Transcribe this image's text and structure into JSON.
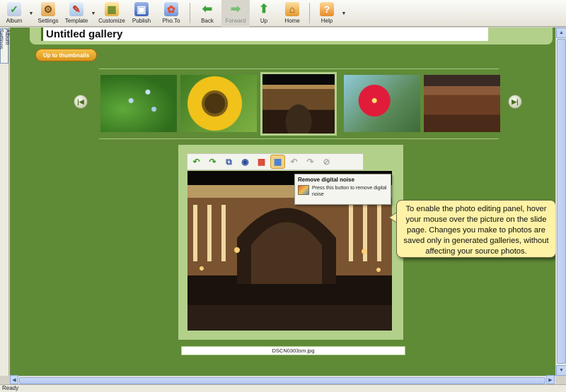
{
  "toolbar": {
    "album": "Album",
    "settings": "Settings",
    "template": "Template",
    "customize": "Customize",
    "publish": "Publish",
    "phoTo": "Pho.To",
    "back": "Back",
    "forward": "Forward",
    "up": "Up",
    "home": "Home",
    "help": "Help"
  },
  "sidePanel": {
    "albumSettingsTab": "Album Settings"
  },
  "gallery": {
    "title": "Untitled gallery",
    "upToThumbnails": "Up to thumbnails",
    "thumbnails": [
      {
        "subject": "green leaves with blue flowers",
        "selected": false
      },
      {
        "subject": "sunflower",
        "selected": false
      },
      {
        "subject": "arch building at night",
        "selected": true
      },
      {
        "subject": "red hibiscus flower",
        "selected": false
      },
      {
        "subject": "colosseum ruins at sunset",
        "selected": false
      }
    ]
  },
  "editor": {
    "tools": [
      {
        "icon": "rotate-left-icon"
      },
      {
        "icon": "rotate-right-icon"
      },
      {
        "icon": "resize-icon"
      },
      {
        "icon": "red-eye-icon"
      },
      {
        "icon": "auto-levels-icon"
      },
      {
        "icon": "remove-noise-icon",
        "active": true
      },
      {
        "icon": "undo-icon",
        "disabled": true
      },
      {
        "icon": "redo-icon",
        "disabled": true
      },
      {
        "icon": "reset-icon",
        "disabled": true
      }
    ],
    "tooltip": {
      "title": "Remove digital noise",
      "text": "Press this button to remove digital noise"
    }
  },
  "callout": {
    "text": "To enable the photo editing panel, hover your mouse over the picture on the slide page. Changes you make to photos are saved only in generated galleries, without affecting your source photos."
  },
  "slide": {
    "filename": "DSCN0303sm.jpg"
  },
  "status": {
    "text": "Ready"
  },
  "colors": {
    "canvas": "#5f8a36",
    "frame": "#b2d089",
    "accentOrange": "#e0a02a",
    "callout": "#fdf2a6"
  }
}
